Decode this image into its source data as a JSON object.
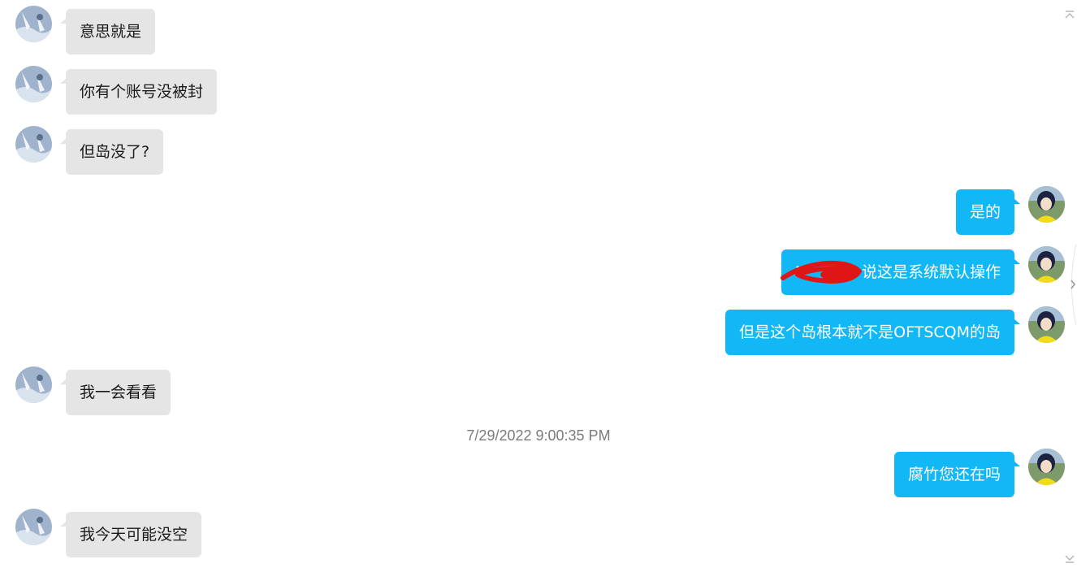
{
  "colors": {
    "incoming_bubble": "#e5e5e5",
    "outgoing_bubble": "#12b7f5",
    "timestamp_text": "#7b7b7b",
    "redaction_scribble": "#e01616"
  },
  "icons": {
    "scroll_up": "chevron-up-icon",
    "scroll_down": "chevron-down-icon",
    "side_expand": "chevron-right-icon"
  },
  "messages": [
    {
      "sender": "other",
      "text": "意思就是"
    },
    {
      "sender": "other",
      "text": "你有个账号没被封"
    },
    {
      "sender": "other",
      "text": "但岛没了?"
    },
    {
      "sender": "self",
      "text": "是的"
    },
    {
      "sender": "self",
      "text_prefix": "N",
      "text_suffix": "说这是系统默认操作",
      "redacted": true
    },
    {
      "sender": "self",
      "text": "但是这个岛根本就不是OFTSCQM的岛"
    },
    {
      "sender": "other",
      "text": "我一会看看"
    },
    {
      "type": "timestamp",
      "text": "7/29/2022 9:00:35 PM"
    },
    {
      "sender": "self",
      "text": "腐竹您还在吗"
    },
    {
      "sender": "other",
      "text": "我今天可能没空"
    }
  ]
}
